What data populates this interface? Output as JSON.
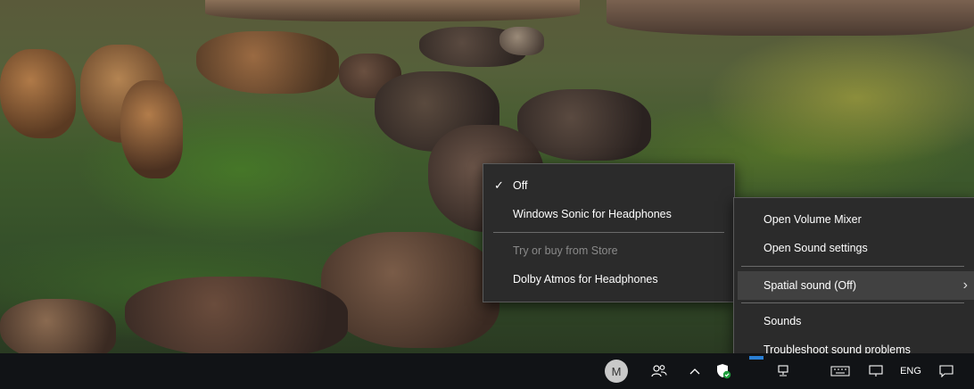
{
  "spatial_submenu": {
    "items": [
      {
        "label": "Off",
        "checked": true,
        "enabled": true
      },
      {
        "label": "Windows Sonic for Headphones",
        "checked": false,
        "enabled": true
      },
      {
        "label": "Try or buy from Store",
        "checked": false,
        "enabled": false
      },
      {
        "label": "Dolby Atmos for Headphones",
        "checked": false,
        "enabled": true
      }
    ]
  },
  "sound_menu": {
    "items": [
      {
        "label": "Open Volume Mixer"
      },
      {
        "label": "Open Sound settings"
      },
      {
        "label": "Spatial sound (Off)",
        "has_submenu": true,
        "highlighted": true
      },
      {
        "label": "Sounds"
      },
      {
        "label": "Troubleshoot sound problems"
      }
    ]
  },
  "taskbar": {
    "avatar_initial": "M",
    "language": "ENG",
    "icons": [
      "people-icon",
      "show-hidden-icons-chevron",
      "windows-security-icon",
      "network-icon",
      "keyboard-icon",
      "notifications-icon"
    ]
  },
  "colors": {
    "menu_background": "#2b2b2b",
    "menu_border": "#5a5a5a",
    "menu_highlight": "#414141",
    "disabled_text": "#8a8a8a",
    "taskbar_background": "#111316",
    "security_green": "#1e9e3c"
  }
}
